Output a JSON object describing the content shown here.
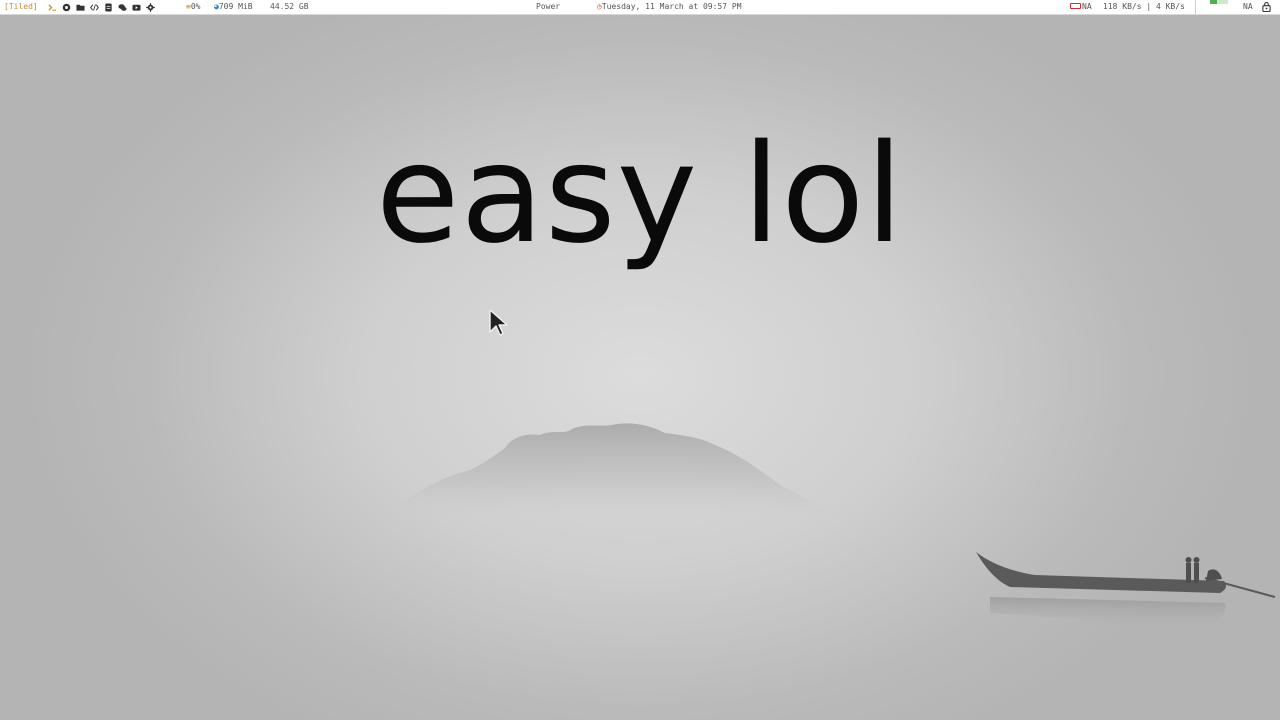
{
  "topbar": {
    "layout_label": "[Tiled]",
    "workspace_icons": [
      "terminal-icon",
      "browser-icon",
      "folder-icon",
      "code-icon",
      "document-icon",
      "chat-icon",
      "video-icon",
      "settings-icon"
    ],
    "cpu_glyph": "≡",
    "cpu": "0%",
    "mem_glyph": "◕",
    "mem": "709 MiB",
    "disk": "44.52 GB",
    "power": "Power",
    "clock_glyph": "◷",
    "clock": "Tuesday, 11 March at 09:57 PM",
    "battery": "NA",
    "network": "118 KB/s | 4 KB/s",
    "volume_level": 0.4,
    "status_na": "NA"
  },
  "desktop": {
    "headline": "easy lol"
  },
  "colors": {
    "accent_orange": "#c98a2b",
    "accent_blue": "#2b8ac9",
    "clock_red": "#d04040",
    "volume_green": "#4caf50"
  }
}
